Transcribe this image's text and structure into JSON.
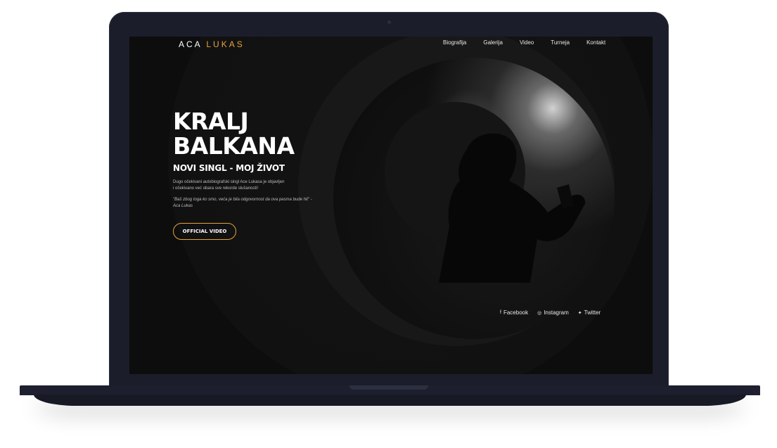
{
  "logo": {
    "first": "ACA",
    "second": "LUKAS",
    "accent_color": "#e7a43a"
  },
  "nav": {
    "items": [
      "Biografija",
      "Galerija",
      "Video",
      "Turneja",
      "Kontakt"
    ]
  },
  "hero": {
    "title_line1": "KRALJ",
    "title_line2": "BALKANA",
    "subtitle": "NOVI SINGL - MOJ ŽIVOT",
    "description": "Dugo očekivani autobiografski singl Ace Lukasa je objavljen i očekivano već obara sve rekorde slušanosti!",
    "quote": "\"Baš zbog toga ko smo, veća je bila odgovornost da ova pesma bude hit\" - Aca Lukas",
    "cta_label": "OFFICIAL VIDEO"
  },
  "social": {
    "facebook": {
      "icon": "facebook-icon",
      "label": "Facebook"
    },
    "instagram": {
      "icon": "instagram-icon",
      "label": "Instagram"
    },
    "twitter": {
      "icon": "twitter-icon",
      "label": "Twitter"
    }
  }
}
